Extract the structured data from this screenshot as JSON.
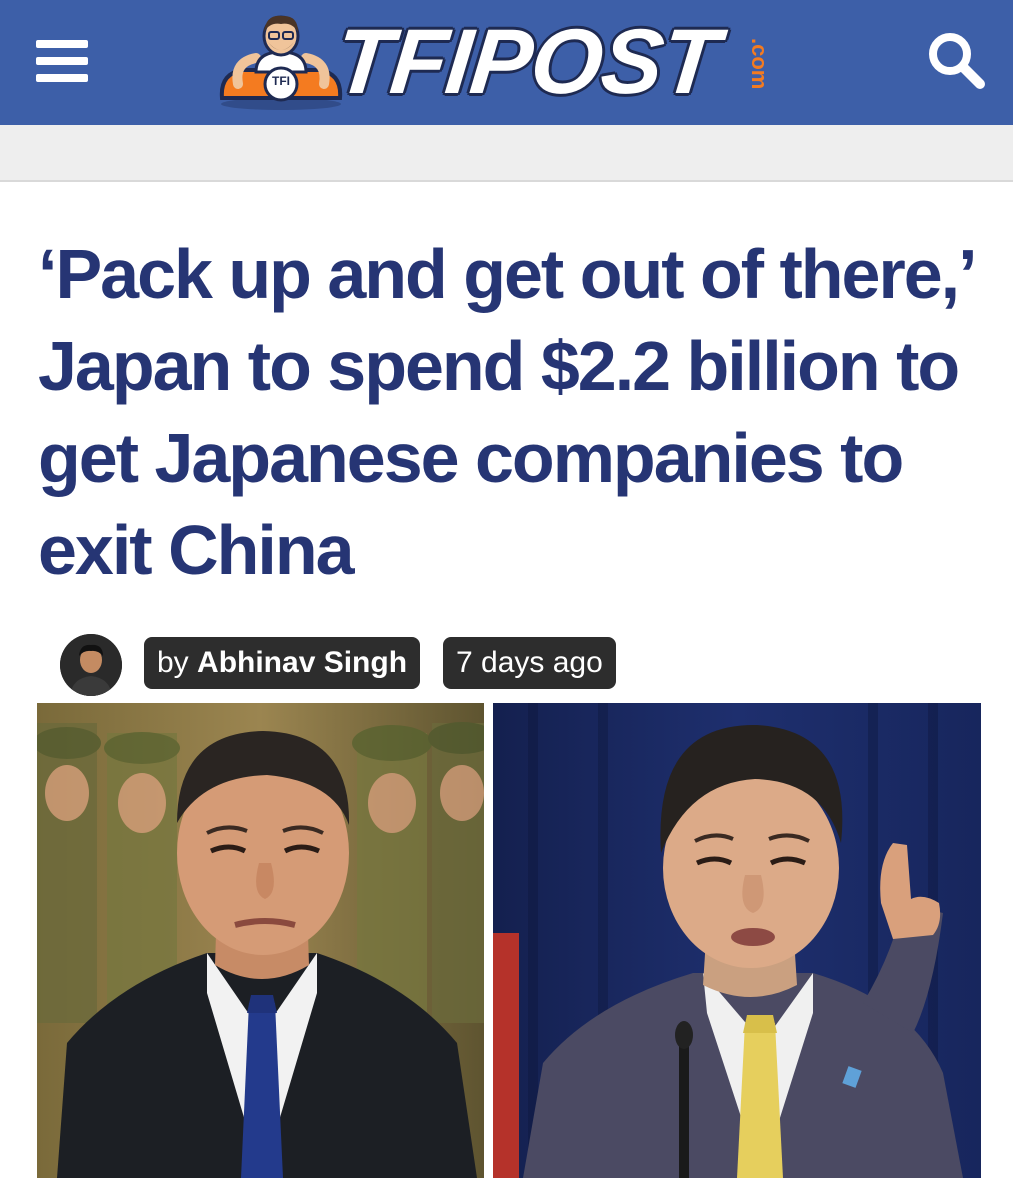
{
  "header": {
    "logo_text": "TFIPOST",
    "logo_com": ".com",
    "mascot_badge": "TFI",
    "colors": {
      "bar": "#3d5fa8",
      "accent": "#f47b20",
      "headline": "#263574"
    },
    "menu_icon": "hamburger-icon",
    "search_icon": "search-icon"
  },
  "article": {
    "title": "‘Pack up and get out of there,’ Japan to spend $2.2 billion to get Japanese companies to exit China",
    "byline_prefix": "by",
    "author": "Abhinav Singh",
    "published": "7 days ago"
  }
}
